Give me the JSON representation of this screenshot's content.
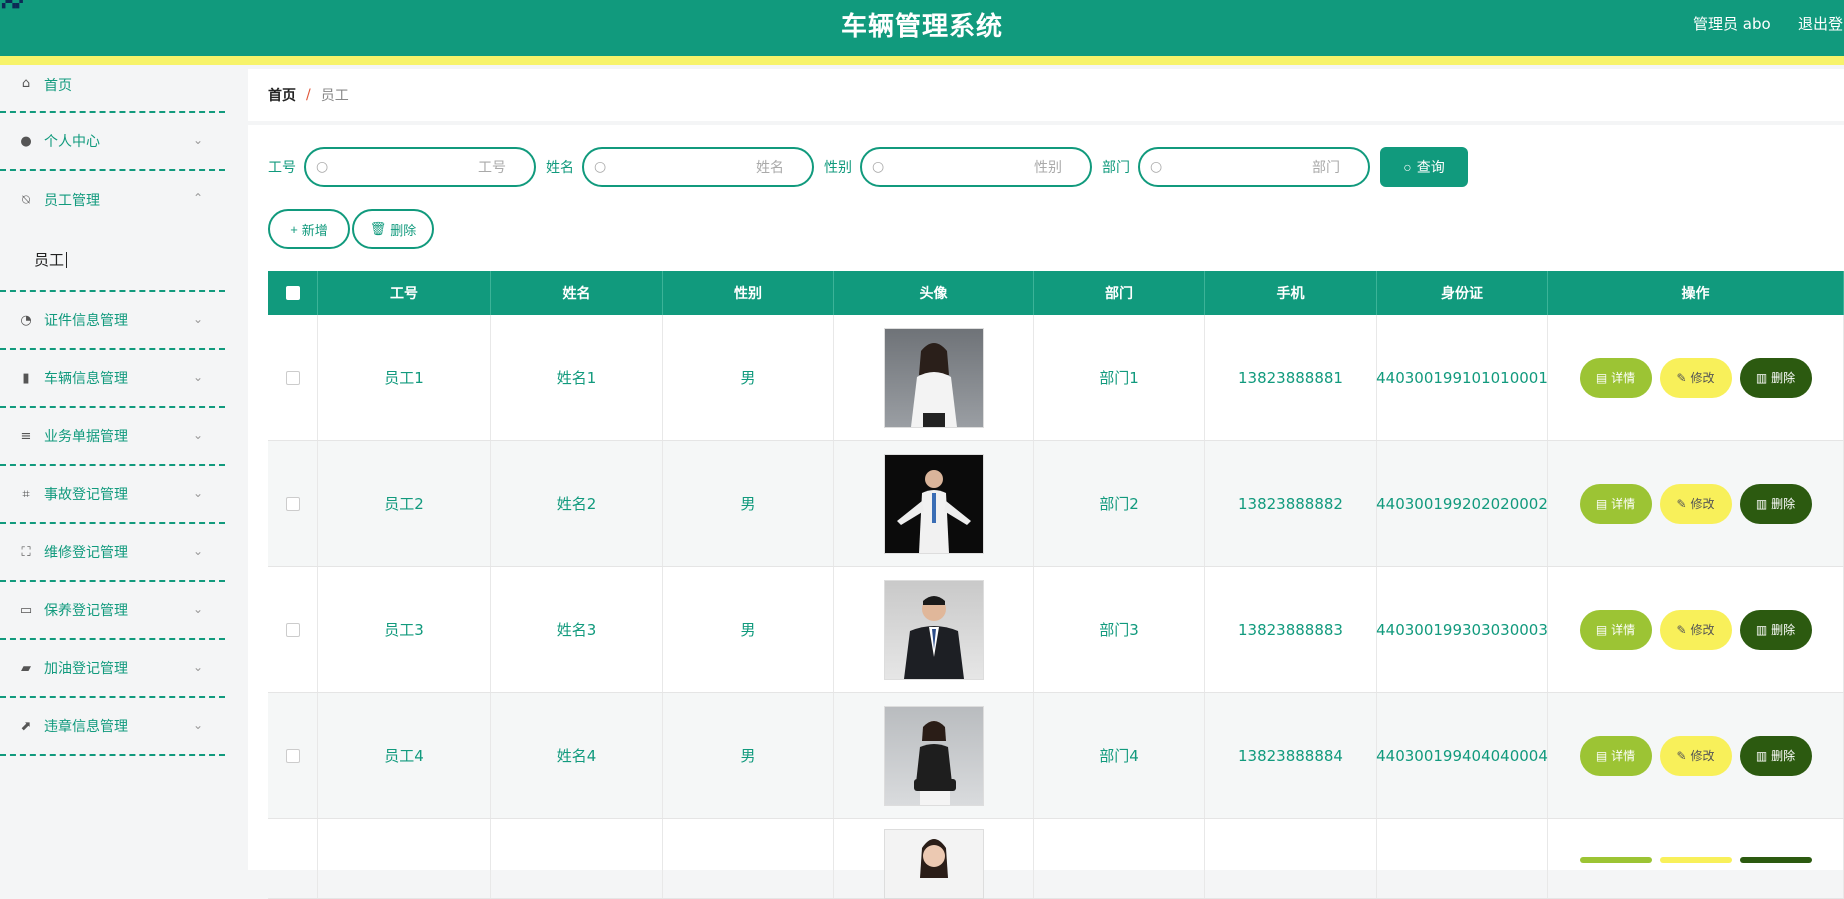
{
  "header": {
    "title": "车辆管理系统",
    "user": "管理员 abo",
    "logout": "退出登录"
  },
  "colors": {
    "primary": "#119a7d",
    "accent_stripe": "#f7f36a",
    "detail": "#9cc434",
    "edit": "#f8f05a",
    "delete": "#2c5a10"
  },
  "sidebar": {
    "items": [
      {
        "label": "首页",
        "icon": "home-icon"
      },
      {
        "label": "个人中心",
        "icon": "user-icon"
      },
      {
        "label": "员工管理",
        "icon": "bell-off-icon",
        "expanded": true,
        "sub": "员工"
      },
      {
        "label": "证件信息管理",
        "icon": "gauge-icon"
      },
      {
        "label": "车辆信息管理",
        "icon": "bars-icon"
      },
      {
        "label": "业务单据管理",
        "icon": "list-icon"
      },
      {
        "label": "事故登记管理",
        "icon": "crop-icon"
      },
      {
        "label": "维修登记管理",
        "icon": "fullscreen-icon"
      },
      {
        "label": "保养登记管理",
        "icon": "card-icon"
      },
      {
        "label": "加油登记管理",
        "icon": "wallet-icon"
      },
      {
        "label": "违章信息管理",
        "icon": "chart-icon"
      }
    ]
  },
  "breadcrumb": {
    "home": "首页",
    "sep": "/",
    "current": "员工"
  },
  "search": {
    "fields": [
      {
        "label": "工号",
        "placeholder": "工号"
      },
      {
        "label": "姓名",
        "placeholder": "姓名"
      },
      {
        "label": "性别",
        "placeholder": "性别"
      },
      {
        "label": "部门",
        "placeholder": "部门"
      }
    ],
    "button": "查询"
  },
  "actions": {
    "add": "新增",
    "delete": "删除"
  },
  "table": {
    "headers": [
      "工号",
      "姓名",
      "性别",
      "头像",
      "部门",
      "手机",
      "身份证",
      "操作"
    ],
    "rows": [
      {
        "id": "员工1",
        "name": "姓名1",
        "gender": "男",
        "dept": "部门1",
        "phone": "13823888881",
        "idcard": "440300199101010001"
      },
      {
        "id": "员工2",
        "name": "姓名2",
        "gender": "男",
        "dept": "部门2",
        "phone": "13823888882",
        "idcard": "440300199202020002"
      },
      {
        "id": "员工3",
        "name": "姓名3",
        "gender": "男",
        "dept": "部门3",
        "phone": "13823888883",
        "idcard": "440300199303030003"
      },
      {
        "id": "员工4",
        "name": "姓名4",
        "gender": "男",
        "dept": "部门4",
        "phone": "13823888884",
        "idcard": "440300199404040004"
      }
    ],
    "ops": {
      "detail": "详情",
      "edit": "修改",
      "delete": "删除"
    }
  }
}
